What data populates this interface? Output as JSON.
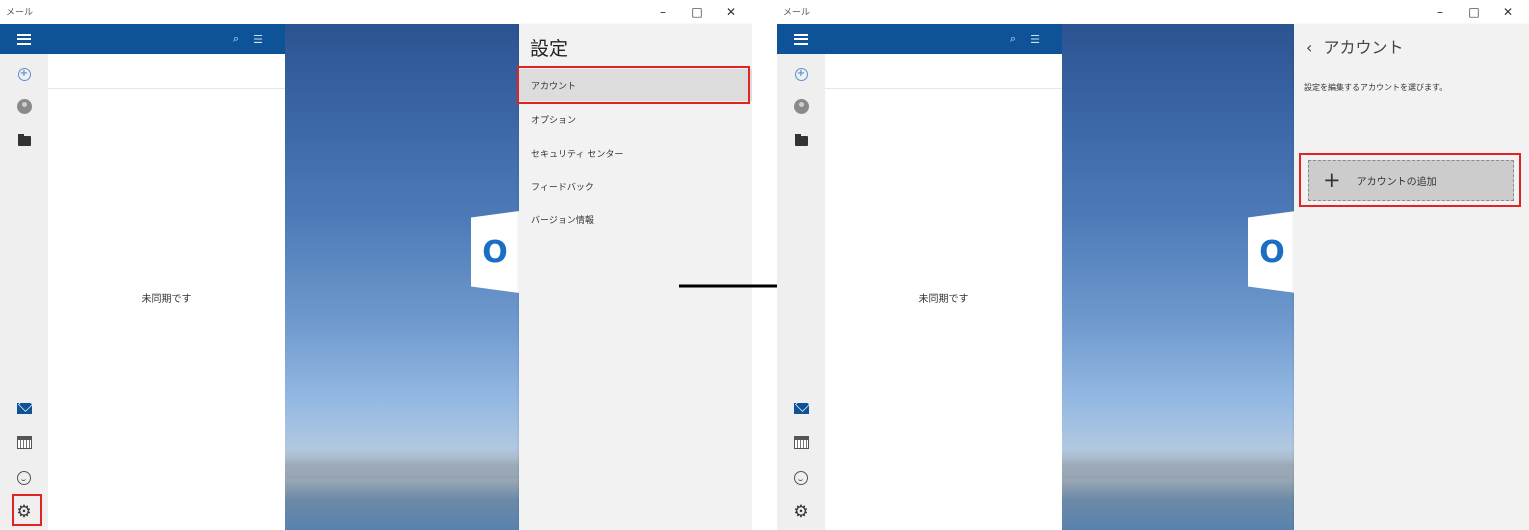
{
  "app_title": "メール",
  "window_controls": {
    "minimize": "–",
    "maximize": "□",
    "close": "✕"
  },
  "list_header_icons": {
    "search": "search-icon",
    "filter": "filter-icon"
  },
  "list_empty_text": "未同期です",
  "left": {
    "settings_title": "設定",
    "settings_items": [
      {
        "label": "アカウント"
      },
      {
        "label": "オプション"
      },
      {
        "label": "セキュリティ センター"
      },
      {
        "label": "フィードバック"
      },
      {
        "label": "バージョン情報"
      }
    ]
  },
  "right": {
    "back_glyph": "‹",
    "account_title": "アカウント",
    "account_description": "設定を編集するアカウントを選びます。",
    "add_account_label": "アカウントの追加",
    "add_account_plus": "+"
  },
  "rail_icons": [
    "hamburger-icon",
    "add-icon",
    "avatar-icon",
    "folder-icon",
    "mail-icon",
    "calendar-icon",
    "feedback-icon",
    "gear-icon"
  ],
  "logo_letter": "O",
  "colors": {
    "header_blue": "#0e5297",
    "highlight_red": "#e02424",
    "flyout_bg": "#f2f2f2"
  }
}
